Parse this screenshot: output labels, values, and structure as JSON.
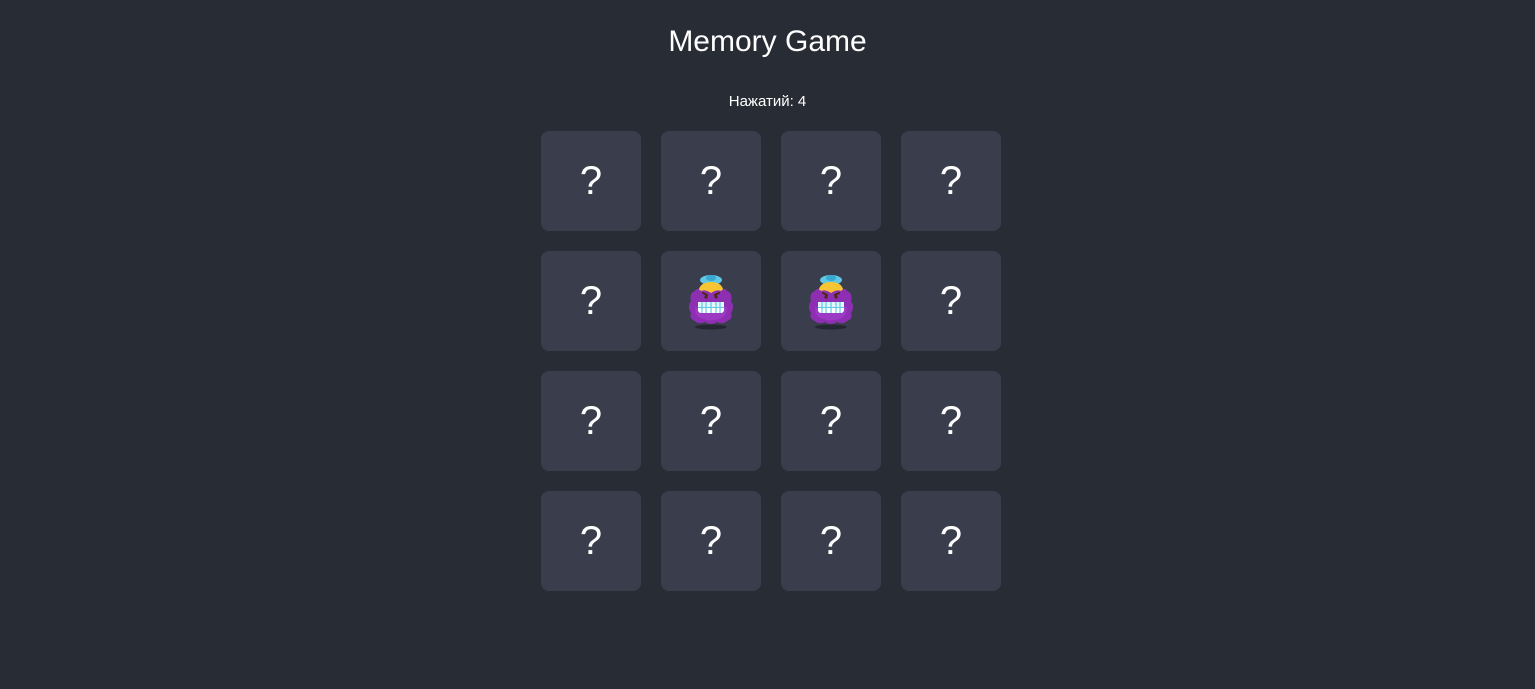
{
  "title": "Memory Game",
  "counter": "Нажатий: 4",
  "hidden_symbol": "?",
  "colors": {
    "background": "#282c35",
    "card": "#3a3d4c",
    "text": "#ffffff"
  },
  "cards": [
    {
      "state": "hidden",
      "icon": "question-mark"
    },
    {
      "state": "hidden",
      "icon": "question-mark"
    },
    {
      "state": "hidden",
      "icon": "question-mark"
    },
    {
      "state": "hidden",
      "icon": "question-mark"
    },
    {
      "state": "hidden",
      "icon": "question-mark"
    },
    {
      "state": "revealed",
      "icon": "purple-monster-emoji"
    },
    {
      "state": "revealed",
      "icon": "purple-monster-emoji"
    },
    {
      "state": "hidden",
      "icon": "question-mark"
    },
    {
      "state": "hidden",
      "icon": "question-mark"
    },
    {
      "state": "hidden",
      "icon": "question-mark"
    },
    {
      "state": "hidden",
      "icon": "question-mark"
    },
    {
      "state": "hidden",
      "icon": "question-mark"
    },
    {
      "state": "hidden",
      "icon": "question-mark"
    },
    {
      "state": "hidden",
      "icon": "question-mark"
    },
    {
      "state": "hidden",
      "icon": "question-mark"
    },
    {
      "state": "hidden",
      "icon": "question-mark"
    }
  ]
}
